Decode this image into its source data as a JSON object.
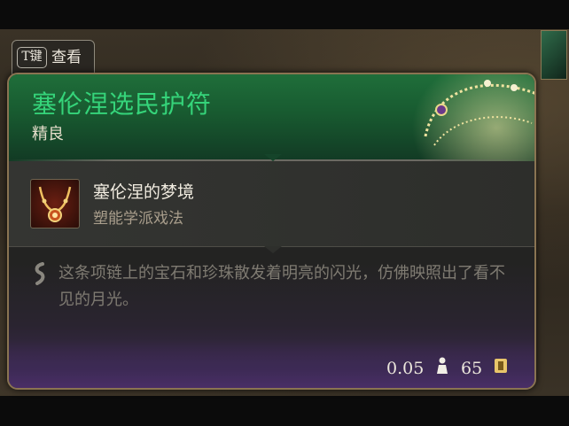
{
  "hint": {
    "key": "T键",
    "label": "查看"
  },
  "item": {
    "name": "塞伦涅选民护符",
    "rarity": "精良",
    "name_color": "#35d47a"
  },
  "spell": {
    "name": "塞伦涅的梦境",
    "school": "塑能学派戏法",
    "icon": "necklace-icon"
  },
  "description": "这条项链上的宝石和珍珠散发着明亮的闪光，仿佛映照出了看不见的月光。",
  "stats": {
    "weight": "0.05",
    "weight_icon": "weight-icon",
    "price": "65",
    "price_icon": "gold-coin-icon"
  }
}
